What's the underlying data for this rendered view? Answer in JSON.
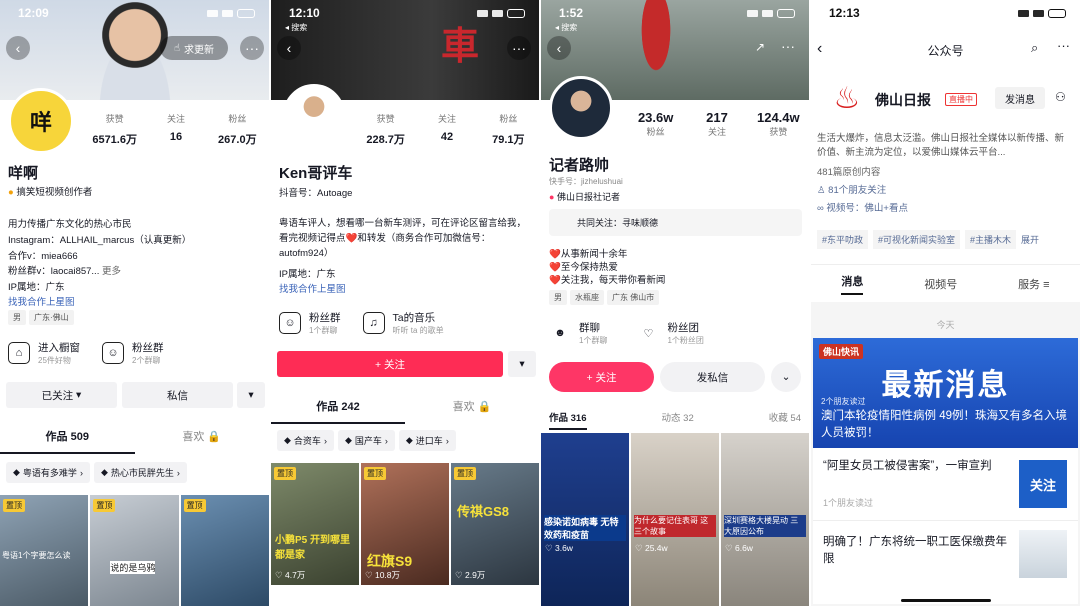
{
  "p1": {
    "time": "12:09",
    "follow_btn": "求更新",
    "name": "咩啊",
    "badge": "搞笑短视频创作者",
    "stats": [
      {
        "label": "获赞",
        "value": "6571.6万"
      },
      {
        "label": "关注",
        "value": "16"
      },
      {
        "label": "粉丝",
        "value": "267.0万"
      }
    ],
    "bio": [
      "用力传播广东文化的热心市民",
      "Instagram：ALLHAIL_marcus（认真更新）",
      "合作v：miea666",
      "粉丝群v：laocai857..."
    ],
    "more": "更多",
    "ip": "IP属地：广东",
    "cooperate": "找我合作上星图",
    "tags": [
      "男",
      "广东·佛山"
    ],
    "shop": "进入橱窗",
    "shop_sub": "25件好物",
    "fans": "粉丝群",
    "fans_sub": "2个群聊",
    "followed": "已关注",
    "message": "私信",
    "tab_works": "作品 509",
    "tab_likes": "喜欢",
    "chips": [
      "粤语有多难学",
      "热心市民胖先生"
    ],
    "thumbs": [
      {
        "pin": "置顶",
        "caption": "粤语1个字要怎么读"
      },
      {
        "pin": "置顶",
        "caption": "说的是乌鸦"
      },
      {
        "pin": "置顶",
        "caption": ""
      }
    ]
  },
  "p2": {
    "time": "12:10",
    "back_src": "◂ 搜索",
    "name": "Ken哥评车",
    "id": "抖音号：Autoage",
    "stats": [
      {
        "label": "获赞",
        "value": "228.7万"
      },
      {
        "label": "关注",
        "value": "42"
      },
      {
        "label": "粉丝",
        "value": "79.1万"
      }
    ],
    "bio": "粤语车评人，想看哪一台新车测评，可在评论区留言给我，看完视频记得点❤️和转发（商务合作可加微信号：autofm924）",
    "ip": "IP属地：广东",
    "cooperate": "找我合作上星图",
    "fans": "粉丝群",
    "fans_sub": "1个群聊",
    "music": "Ta的音乐",
    "music_sub": "听听 ta 的歌单",
    "follow": "+ 关注",
    "tab_works": "作品 242",
    "tab_likes": "喜欢",
    "chips": [
      "合资车",
      "国产车",
      "进口车"
    ],
    "thumbs": [
      {
        "pin": "置顶",
        "caption": "小鹏P5 开到哪里都是家",
        "likes": "♡ 4.7万"
      },
      {
        "pin": "置顶",
        "caption": "红旗S9",
        "likes": "♡ 10.8万"
      },
      {
        "pin": "置顶",
        "caption": "传祺GS8",
        "likes": "♡ 2.9万"
      }
    ]
  },
  "p3": {
    "time": "1:52",
    "back_src": "◂ 搜索",
    "name": "记者路帅",
    "id": "快手号：jizhelushuai",
    "org": "佛山日报社记者",
    "stats": [
      {
        "label": "粉丝",
        "value": "23.6w"
      },
      {
        "label": "关注",
        "value": "217"
      },
      {
        "label": "获赞",
        "value": "124.4w"
      }
    ],
    "common": "共同关注：寻味顺德",
    "bio": [
      "❤️从事新闻十余年",
      "❤️至今保持热爱",
      "❤️关注我，每天带你看新闻"
    ],
    "tags": [
      "男",
      "水瓶座",
      "广东 佛山市"
    ],
    "group": "群聊",
    "group_sub": "1个群聊",
    "team": "粉丝团",
    "team_sub": "1个粉丝团",
    "follow": "+ 关注",
    "message": "发私信",
    "tabs": [
      "作品 316",
      "动态 32",
      "收藏 54"
    ],
    "thumbs": [
      {
        "caption": "感染诺如病毒 无特效药和疫苗",
        "likes": "♡ 3.6w"
      },
      {
        "caption": "为什么要记住表哥 这三个故事",
        "likes": "♡ 25.4w"
      },
      {
        "caption": "深圳赛格大楼晃动 三大原因公布",
        "likes": "♡ 6.6w"
      }
    ]
  },
  "p4": {
    "time": "12:13",
    "title": "公众号",
    "name": "佛山日报",
    "live": "直播中",
    "send": "发消息",
    "desc": "生活大爆炸，信息太泛滥。佛山日报社全媒体以新传播、新价值、新主流为定位，以爱佛山媒体云平台...",
    "count": "481篇原创内容",
    "friends": "81个朋友关注",
    "video": "视频号：佛山+看点",
    "tags": [
      "#东平叻政",
      "#可视化新闻实验室",
      "#主播木木"
    ],
    "expand": "展开",
    "tabs": [
      "消息",
      "视频号",
      "服务"
    ],
    "today": "今天",
    "banner_logo": "佛山快讯",
    "banner_big": "最新消息",
    "banner_sub": "2个朋友读过",
    "headline": "澳门本轮疫情阳性病例 49例！珠海又有多名入境人员被罚！",
    "articles": [
      {
        "title": "“阿里女员工被侵害案”，一审宣判",
        "sub": "1个朋友读过",
        "thumb": "关注"
      },
      {
        "title": "明确了！广东将统一职工医保缴费年限",
        "sub": "",
        "thumb": ""
      }
    ]
  },
  "colors": {
    "red": "#fe2c55",
    "blue": "#3a63b8",
    "banner_blue": "#1f56c6",
    "p3red": "#fe3666"
  }
}
